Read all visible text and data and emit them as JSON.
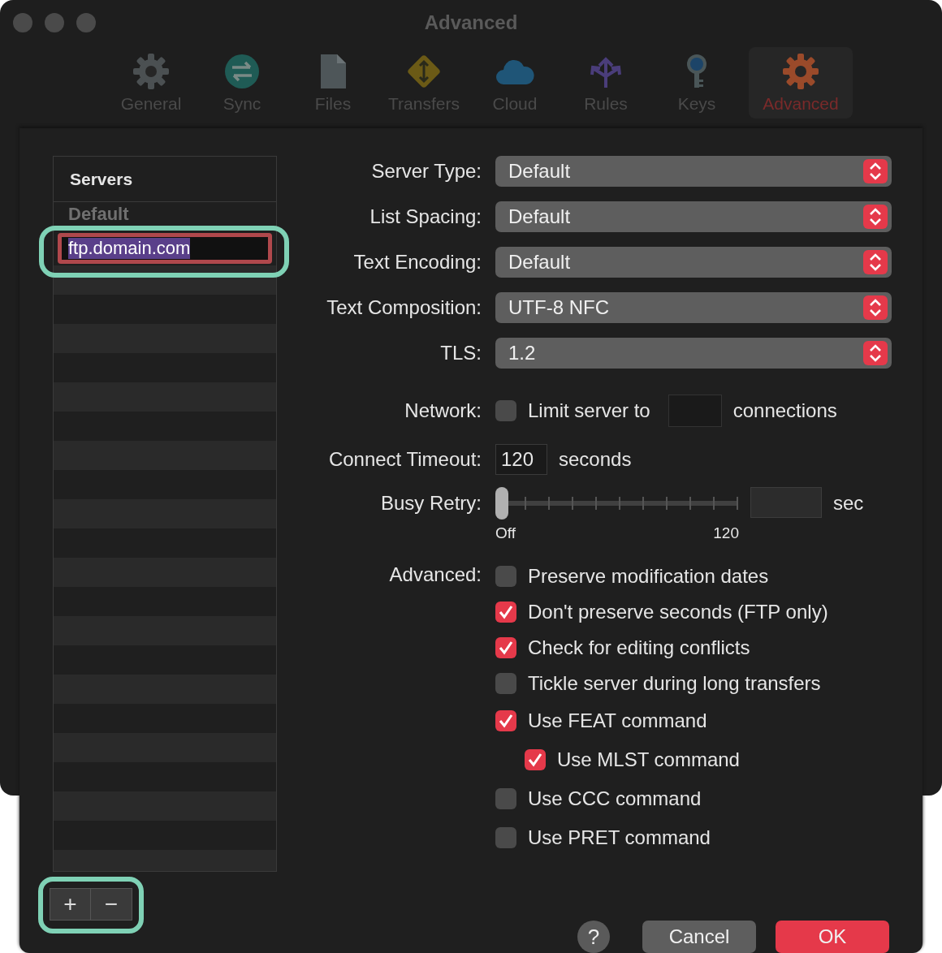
{
  "window": {
    "title": "Advanced"
  },
  "toolbar": {
    "items": [
      {
        "label": "General",
        "selected": false
      },
      {
        "label": "Sync",
        "selected": false
      },
      {
        "label": "Files",
        "selected": false
      },
      {
        "label": "Transfers",
        "selected": false
      },
      {
        "label": "Cloud",
        "selected": false
      },
      {
        "label": "Rules",
        "selected": false
      },
      {
        "label": "Keys",
        "selected": false
      },
      {
        "label": "Advanced",
        "selected": true
      }
    ]
  },
  "sidebar": {
    "header": "Servers",
    "items": [
      {
        "label": "Default",
        "selected": false
      },
      {
        "label": "ftp.domain.com",
        "selected": true
      }
    ]
  },
  "popups": [
    {
      "label": "Server Type:",
      "value": "Default"
    },
    {
      "label": "List Spacing:",
      "value": "Default"
    },
    {
      "label": "Text Encoding:",
      "value": "Default"
    },
    {
      "label": "Text Composition:",
      "value": "UTF-8 NFC"
    },
    {
      "label": "TLS:",
      "value": "1.2"
    }
  ],
  "network": {
    "label": "Network:",
    "checkbox_label": "Limit server to",
    "checked": false,
    "suffix": "connections"
  },
  "connect_timeout": {
    "label": "Connect Timeout:",
    "value": "120",
    "suffix": "seconds"
  },
  "busy_retry": {
    "label": "Busy Retry:",
    "level": 0,
    "min_label": "Off",
    "max_label": "120",
    "suffix": "sec"
  },
  "advanced": {
    "label": "Advanced:",
    "options": [
      {
        "label": "Preserve modification dates",
        "checked": false
      },
      {
        "label": "Don't preserve seconds (FTP only)",
        "checked": true
      },
      {
        "label": "Check for editing conflicts",
        "checked": true
      },
      {
        "label": "Tickle server during long transfers",
        "checked": false
      },
      {
        "label": "Use FEAT command",
        "checked": true,
        "children": [
          {
            "label": "Use MLST command",
            "checked": true
          }
        ]
      },
      {
        "label": "Use CCC command",
        "checked": false
      },
      {
        "label": "Use PRET command",
        "checked": false
      }
    ]
  },
  "buttons": {
    "help": "?",
    "cancel": "Cancel",
    "ok": "OK"
  },
  "list_buttons": [
    "+",
    "−"
  ]
}
